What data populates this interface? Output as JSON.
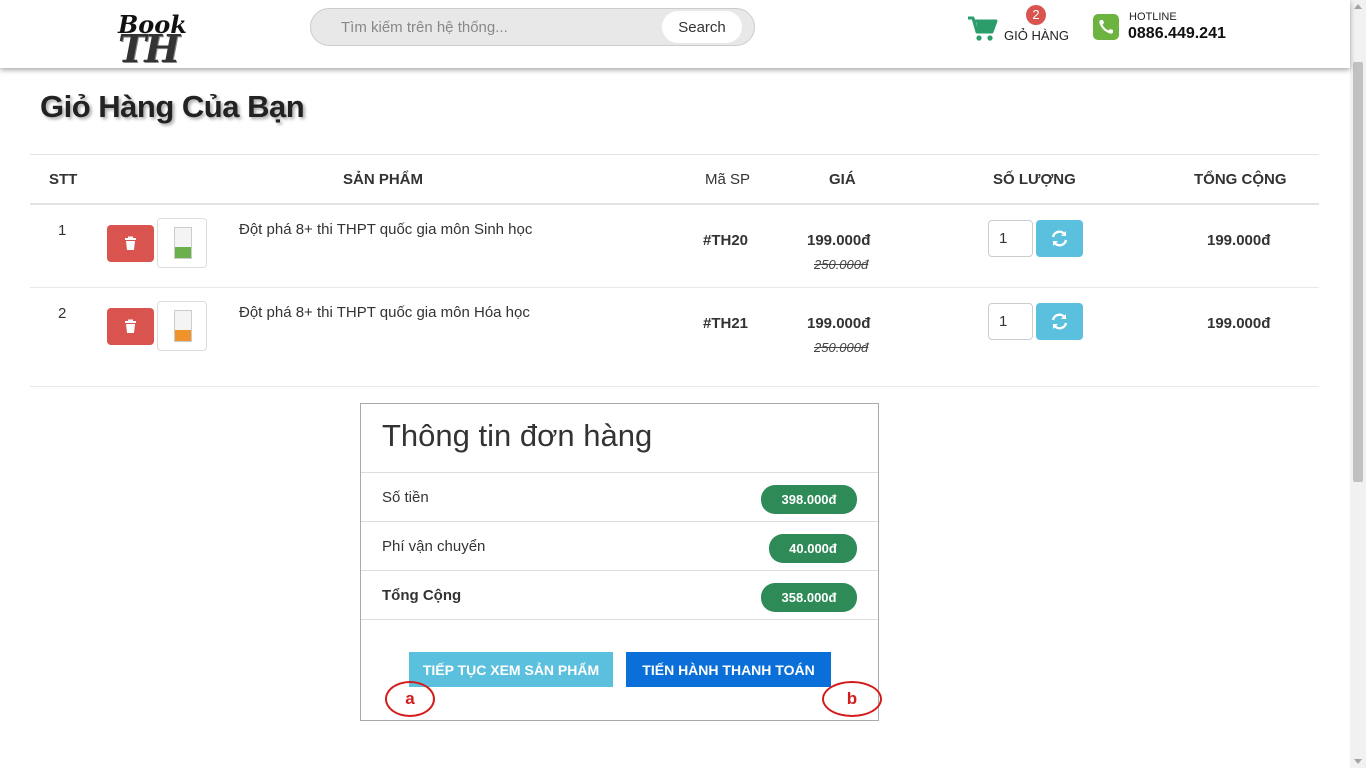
{
  "header": {
    "logo_th": "TH",
    "logo_book": "Book",
    "search_placeholder": "Tìm kiếm trên hệ thống...",
    "search_button": "Search",
    "cart_count": "2",
    "cart_label": "GIỎ HÀNG",
    "hotline_label": "HOTLINE",
    "hotline_number": "0886.449.241"
  },
  "page_title": "Giỏ Hàng Của Bạn",
  "table": {
    "headers": {
      "stt": "STT",
      "product": "SẢN PHẨM",
      "code": "Mã SP",
      "price": "GIÁ",
      "quantity": "SỐ LƯỢNG",
      "total": "TỔNG CỘNG"
    },
    "rows": [
      {
        "stt": "1",
        "name": "Đột phá 8+ thi THPT quốc gia môn Sinh học",
        "code": "#TH20",
        "price": "199.000đ",
        "old_price": "250.000đ",
        "quantity": "1",
        "total": "199.000đ",
        "cover_color": "#6ab04c"
      },
      {
        "stt": "2",
        "name": "Đột phá 8+ thi THPT quốc gia môn Hóa học",
        "code": "#TH21",
        "price": "199.000đ",
        "old_price": "250.000đ",
        "quantity": "1",
        "total": "199.000đ",
        "cover_color": "#f0932b"
      }
    ]
  },
  "summary": {
    "title": "Thông tin đơn hàng",
    "subtotal_label": "Số tiền",
    "subtotal_value": "398.000đ",
    "shipping_label": "Phí vận chuyển",
    "shipping_value": "40.000đ",
    "total_label": "Tổng Cộng",
    "total_value": "358.000đ",
    "continue_button": "TIẾP TỤC XEM SẢN PHẨM",
    "checkout_button": "TIẾN HÀNH THANH TOÁN",
    "mark_a": "a",
    "mark_b": "b"
  },
  "colors": {
    "delete": "#d9534f",
    "refresh": "#5bc0de",
    "pill": "#2e8b57",
    "checkout": "#0a6fd8",
    "cart_icon": "#2a9d6a",
    "phone_icon": "#6cb33f"
  },
  "icons": [
    "cart-icon",
    "phone-icon",
    "trash-icon",
    "refresh-icon"
  ]
}
